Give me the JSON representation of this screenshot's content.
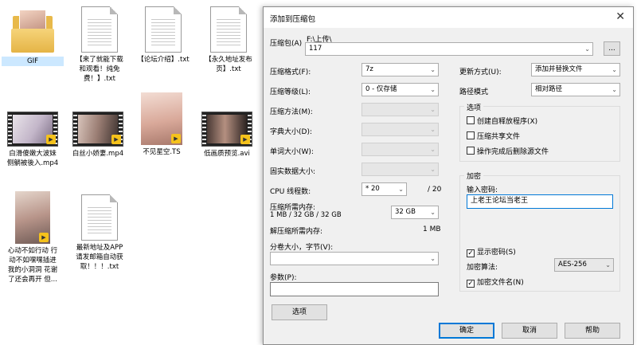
{
  "desktop": {
    "files": [
      {
        "name": "GIF"
      },
      {
        "name": "【来了就能下载\n和观看！纯免\n费！】.txt"
      },
      {
        "name": "【论坛介绍】.txt"
      },
      {
        "name": "【永久地址发布\n页】.txt"
      },
      {
        "name": "白滑傻嫩大波妹\n侧躺被後入.mp4"
      },
      {
        "name": "白丝小娇妻.mp4"
      },
      {
        "name": "不见星空.TS"
      },
      {
        "name": "低画质预览.avi"
      },
      {
        "name": "心动不如行动 行\n动不如嘿嘿插进\n我的小洞洞 花谢\n了还会再开 但..."
      },
      {
        "name": "最新地址及APP\n请发邮箱自动获\n取！！！.txt"
      }
    ],
    "badge_text": "Player"
  },
  "dialog": {
    "title": "添加到压缩包",
    "close_glyph": "✕",
    "archive_label": "压缩包(A)",
    "archive_path": "F:\\上传\\",
    "archive_name": "117",
    "browse_label": "...",
    "format_label": "压缩格式(F):",
    "format_value": "7z",
    "level_label": "压缩等级(L):",
    "level_value": "0 - 仅存储",
    "method_label": "压缩方法(M):",
    "dict_label": "字典大小(D):",
    "word_label": "单词大小(W):",
    "solid_label": "固实数据大小:",
    "cpu_label": "CPU 线程数:",
    "cpu_value": "* 20",
    "cpu_total": "/ 20",
    "mem_label": "压缩所需内存:",
    "mem_detail": "1 MB / 32 GB / 32 GB",
    "mem_value": "32 GB",
    "decomp_label": "解压缩所需内存:",
    "decomp_value": "1 MB",
    "split_label": "分卷大小，字节(V):",
    "params_label": "参数(P):",
    "options_btn": "选项",
    "update_label": "更新方式(U):",
    "update_value": "添加并替换文件",
    "path_label": "路径模式",
    "path_value": "相对路径",
    "options_group": "选项",
    "opt_sfx": "创建自释放程序(X)",
    "opt_shared": "压缩共享文件",
    "opt_delete": "操作完成后删除源文件",
    "encrypt_group": "加密",
    "pwd_label": "输入密码:",
    "pwd_value": "上老王论坛当老王",
    "show_pwd": "显示密码(S)",
    "enc_method_label": "加密算法:",
    "enc_method_value": "AES-256",
    "enc_names": "加密文件名(N)",
    "ok": "确定",
    "cancel": "取消",
    "help": "帮助"
  },
  "colors": {
    "accent": "#0078d7",
    "dialog_bg": "#f0f0f0"
  }
}
